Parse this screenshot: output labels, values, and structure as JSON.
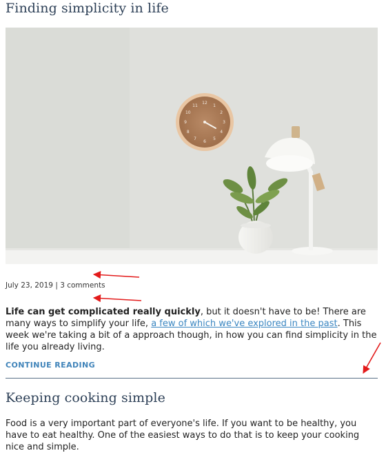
{
  "posts": [
    {
      "title": "Finding simplicity in life",
      "date": "July 23, 2019",
      "separator": "|",
      "comments": "3 comments",
      "excerpt_bold": "Life can get complicated really quickly",
      "excerpt_text_1": ", but it doesn't have to be! There are many ways to simplify your life, ",
      "excerpt_link": "a few of which we've explored in the past",
      "excerpt_text_2": ". This week we're taking a bit of a approach though, in how you can find simplicity in the life you already living.",
      "read_more": "CONTINUE READING"
    },
    {
      "title": "Keeping cooking simple",
      "excerpt_text": "Food is a very important part of everyone's life. If you want to be healthy, you have to eat healthy. One of the easiest ways to do that is to keep your cooking nice and simple."
    }
  ],
  "hero_image": {
    "clock_numerals": [
      "12",
      "1",
      "2",
      "3",
      "4",
      "5",
      "6",
      "7",
      "8",
      "9",
      "10",
      "11"
    ]
  },
  "colors": {
    "title": "#2c3f56",
    "link": "#3a86c1",
    "annotation_arrow": "#e31b1b"
  }
}
